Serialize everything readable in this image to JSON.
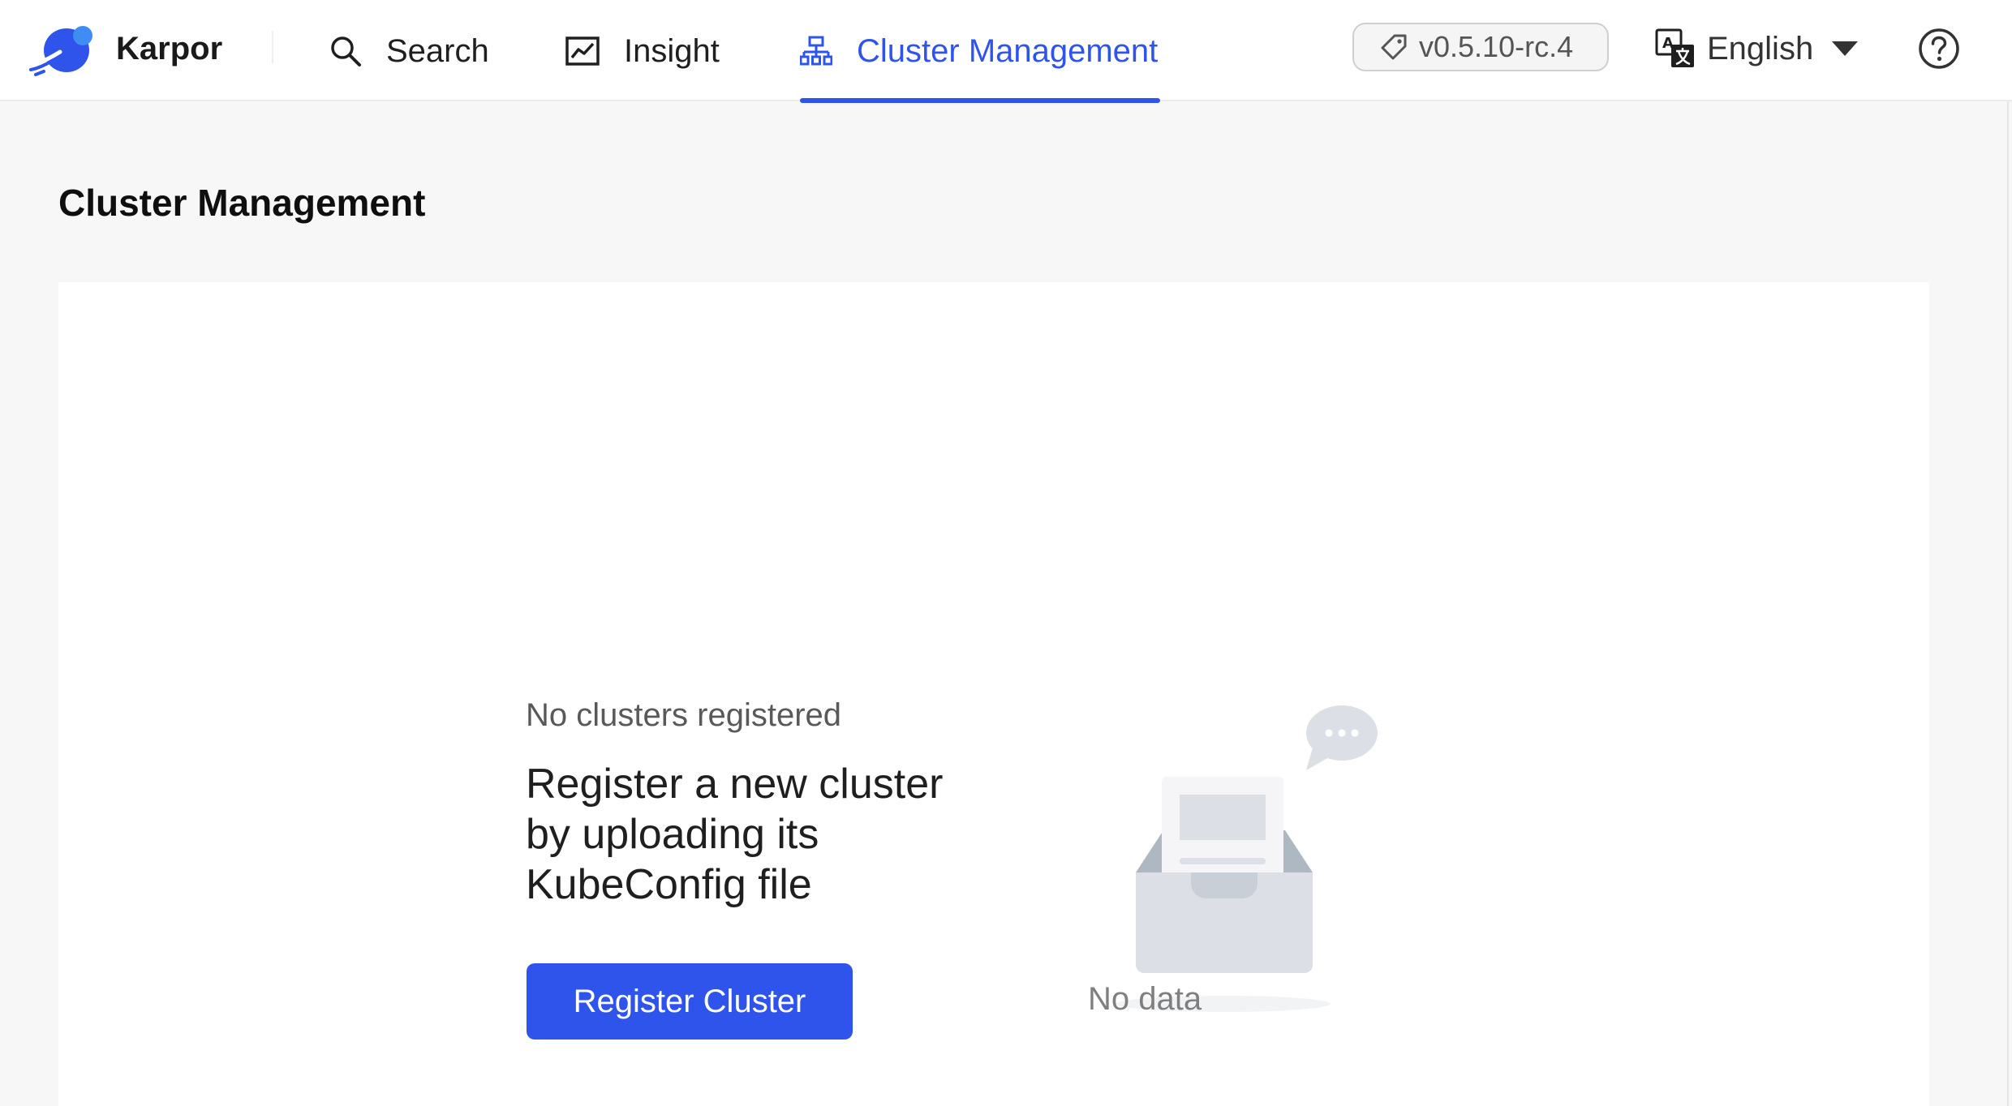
{
  "header": {
    "brand": "Karpor",
    "nav": [
      {
        "label": "Search",
        "icon": "search-icon",
        "active": false
      },
      {
        "label": "Insight",
        "icon": "chart-line-icon",
        "active": false
      },
      {
        "label": "Cluster Management",
        "icon": "cluster-tree-icon",
        "active": true
      }
    ],
    "version": "v0.5.10-rc.4",
    "language": "English"
  },
  "page": {
    "title": "Cluster Management"
  },
  "empty_state": {
    "subtitle": "No clusters registered",
    "headline_lines": [
      "Register a new cluster",
      "by uploading its",
      "KubeConfig file"
    ],
    "button_label": "Register Cluster",
    "no_data_label": "No data"
  },
  "colors": {
    "accent": "#2f54eb",
    "page_background": "#f7f7f7",
    "card_background": "#ffffff"
  }
}
